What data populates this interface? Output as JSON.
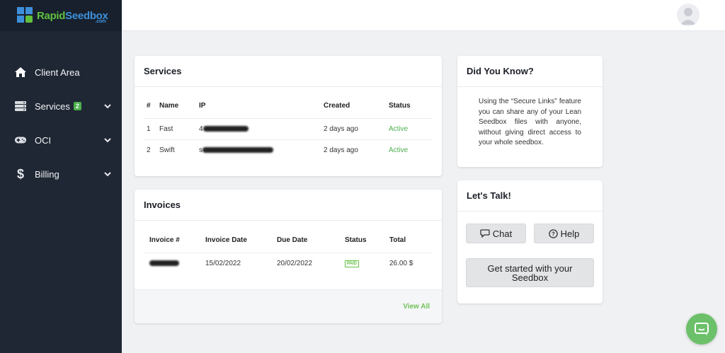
{
  "brand": {
    "name_part1": "Rapid",
    "name_part2": "Seedbox",
    "suffix": ".com"
  },
  "sidebar": {
    "items": [
      {
        "label": "Client Area",
        "icon": "home-icon"
      },
      {
        "label": "Services",
        "icon": "server-icon",
        "badge": "2"
      },
      {
        "label": "OCI",
        "icon": "gamepad-icon"
      },
      {
        "label": "Billing",
        "icon": "dollar-icon"
      }
    ]
  },
  "services": {
    "title": "Services",
    "columns": [
      "#",
      "Name",
      "IP",
      "Created",
      "Status"
    ],
    "rows": [
      {
        "num": "1",
        "name": "Fast",
        "ip_prefix": "4",
        "created": "2 days ago",
        "status": "Active"
      },
      {
        "num": "2",
        "name": "Swift",
        "ip_prefix": "s",
        "created": "2 days ago",
        "status": "Active"
      }
    ]
  },
  "invoices": {
    "title": "Invoices",
    "columns": [
      "Invoice #",
      "Invoice Date",
      "Due Date",
      "Status",
      "Total"
    ],
    "rows": [
      {
        "invoice_date": "15/02/2022",
        "due_date": "20/02/2022",
        "status": "PAID",
        "total": "26.00 $"
      }
    ],
    "view_all": "View All"
  },
  "did_you_know": {
    "title": "Did You Know?",
    "text": "Using the “Secure Links” feature you can share any of your Lean Seedbox files with anyone, without giving direct access to your whole seedbox."
  },
  "lets_talk": {
    "title": "Let's Talk!",
    "chat_label": "Chat",
    "help_label": "Help",
    "get_started_label": "Get started with your Seedbox"
  },
  "colors": {
    "sidebar": "#1f2734",
    "accent_green": "#4caf50",
    "brand_blue": "#3e8fd9"
  }
}
